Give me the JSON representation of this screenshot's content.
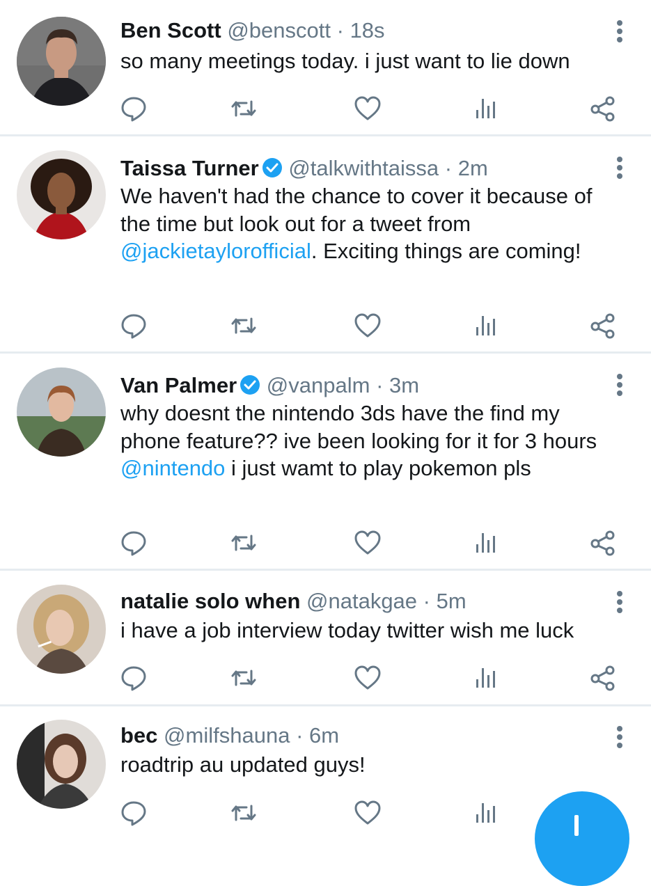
{
  "colors": {
    "accent": "#1da1f2",
    "name": "#14171a",
    "meta": "#657786",
    "divider": "#e6ecf0"
  },
  "tweets": [
    {
      "name": "Ben Scott",
      "verified": false,
      "handle": "@benscott",
      "sep": "·",
      "time": "18s",
      "body": [
        {
          "t": "so many meetings today. i just want to lie down"
        }
      ]
    },
    {
      "name": "Taissa Turner",
      "verified": true,
      "handle": "@talkwithtaissa",
      "sep": "·",
      "time": "2m",
      "body": [
        {
          "t": "We haven't had the chance to cover it because of the time but look out for a tweet from "
        },
        {
          "t": "@jackietaylorofficial",
          "mention": true
        },
        {
          "t": ". Exciting things are coming!"
        }
      ]
    },
    {
      "name": "Van Palmer",
      "verified": true,
      "handle": "@vanpalm",
      "sep": "·",
      "time": "3m",
      "body": [
        {
          "t": "why doesnt the nintendo 3ds have the find my phone feature?? ive been looking for it for 3 hours "
        },
        {
          "t": "@nintendo",
          "mention": true
        },
        {
          "t": " i just wamt to play pokemon pls"
        }
      ]
    },
    {
      "name": "natalie solo when",
      "verified": false,
      "handle": "@natakgae",
      "sep": "·",
      "time": "5m",
      "body": [
        {
          "t": "i have a job interview today twitter wish me luck"
        }
      ]
    },
    {
      "name": "bec",
      "verified": false,
      "handle": "@milfshauna",
      "sep": "·",
      "time": "6m",
      "body": [
        {
          "t": "roadtrip au updated guys!"
        }
      ]
    }
  ],
  "actions": [
    "reply-icon",
    "retweet-icon",
    "like-icon",
    "analytics-icon",
    "share-icon"
  ],
  "fab": {
    "icon": "compose-plus-icon"
  }
}
